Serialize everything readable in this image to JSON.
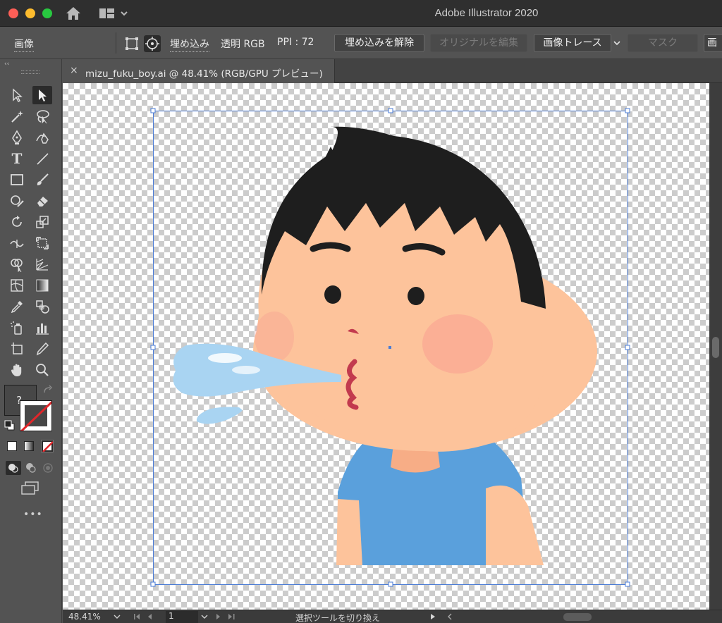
{
  "window": {
    "app_title": "Adobe Illustrator 2020"
  },
  "control_bar": {
    "object_type": "画像",
    "embed_label": "埋め込み",
    "color_mode": "透明 RGB",
    "ppi": "PPI : 72",
    "unembed_button": "埋め込みを解除",
    "edit_original_button": "オリジナルを編集",
    "image_trace_button": "画像トレース",
    "mask_button": "マスク",
    "next_button": "画"
  },
  "toolbar": {
    "collapse_glyph": "‹‹",
    "fill_stroke_unknown": "?",
    "more_tools": "•••"
  },
  "document": {
    "tab_title": "mizu_fuku_boy.ai @ 48.41% (RGB/GPU プレビュー)",
    "close_glyph": "×"
  },
  "status_bar": {
    "zoom": "48.41%",
    "artboard_number": "1",
    "current_tool": "選択ツールを切り換え"
  },
  "colors": {
    "selection_blue": "#4a7bd6",
    "skin": "#fdc39b",
    "shirt": "#5aa0dc",
    "hair": "#1e1e1e",
    "water": "#a9d4f2"
  }
}
